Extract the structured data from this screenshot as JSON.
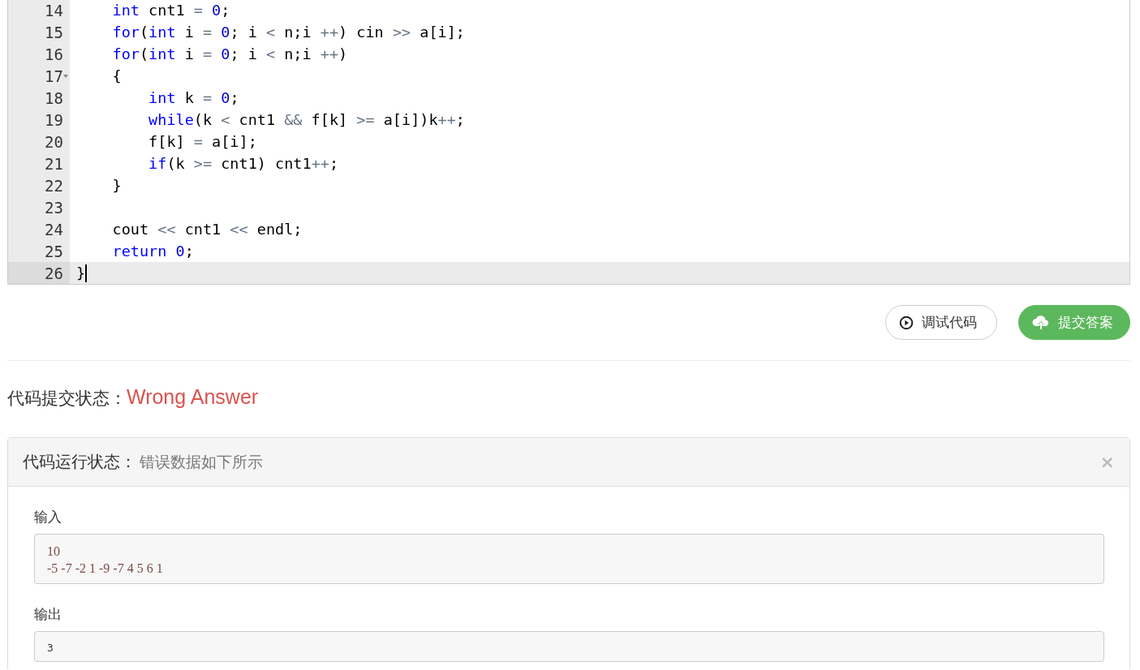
{
  "editor": {
    "lines": [
      {
        "number": "14",
        "foldable": false,
        "active": false,
        "tokens": [
          {
            "kind": "keyword",
            "text": "    int"
          },
          {
            "kind": "plain",
            "text": " cnt1 "
          },
          {
            "kind": "operator",
            "text": "= "
          },
          {
            "kind": "number",
            "text": "0"
          },
          {
            "kind": "plain",
            "text": ";"
          }
        ]
      },
      {
        "number": "15",
        "foldable": false,
        "active": false,
        "tokens": [
          {
            "kind": "keyword",
            "text": "    for"
          },
          {
            "kind": "plain",
            "text": "("
          },
          {
            "kind": "keyword",
            "text": "int"
          },
          {
            "kind": "plain",
            "text": " i "
          },
          {
            "kind": "operator",
            "text": "= "
          },
          {
            "kind": "number",
            "text": "0"
          },
          {
            "kind": "plain",
            "text": "; i "
          },
          {
            "kind": "operator",
            "text": "<"
          },
          {
            "kind": "plain",
            "text": " n;i "
          },
          {
            "kind": "operator",
            "text": "++"
          },
          {
            "kind": "plain",
            "text": ") cin "
          },
          {
            "kind": "operator",
            "text": ">>"
          },
          {
            "kind": "plain",
            "text": " a[i];"
          }
        ]
      },
      {
        "number": "16",
        "foldable": false,
        "active": false,
        "tokens": [
          {
            "kind": "keyword",
            "text": "    for"
          },
          {
            "kind": "plain",
            "text": "("
          },
          {
            "kind": "keyword",
            "text": "int"
          },
          {
            "kind": "plain",
            "text": " i "
          },
          {
            "kind": "operator",
            "text": "= "
          },
          {
            "kind": "number",
            "text": "0"
          },
          {
            "kind": "plain",
            "text": "; i "
          },
          {
            "kind": "operator",
            "text": "<"
          },
          {
            "kind": "plain",
            "text": " n;i "
          },
          {
            "kind": "operator",
            "text": "++"
          },
          {
            "kind": "plain",
            "text": ")"
          }
        ]
      },
      {
        "number": "17",
        "foldable": true,
        "active": false,
        "tokens": [
          {
            "kind": "plain",
            "text": "    {"
          }
        ]
      },
      {
        "number": "18",
        "foldable": false,
        "active": false,
        "tokens": [
          {
            "kind": "keyword",
            "text": "        int"
          },
          {
            "kind": "plain",
            "text": " k "
          },
          {
            "kind": "operator",
            "text": "= "
          },
          {
            "kind": "number",
            "text": "0"
          },
          {
            "kind": "plain",
            "text": ";"
          }
        ]
      },
      {
        "number": "19",
        "foldable": false,
        "active": false,
        "tokens": [
          {
            "kind": "keyword",
            "text": "        while"
          },
          {
            "kind": "plain",
            "text": "(k "
          },
          {
            "kind": "operator",
            "text": "<"
          },
          {
            "kind": "plain",
            "text": " cnt1 "
          },
          {
            "kind": "operator",
            "text": "&&"
          },
          {
            "kind": "plain",
            "text": " f[k] "
          },
          {
            "kind": "operator",
            "text": ">="
          },
          {
            "kind": "plain",
            "text": " a[i])k"
          },
          {
            "kind": "operator",
            "text": "++"
          },
          {
            "kind": "plain",
            "text": ";"
          }
        ]
      },
      {
        "number": "20",
        "foldable": false,
        "active": false,
        "tokens": [
          {
            "kind": "plain",
            "text": "        f[k] "
          },
          {
            "kind": "operator",
            "text": "="
          },
          {
            "kind": "plain",
            "text": " a[i];"
          }
        ]
      },
      {
        "number": "21",
        "foldable": false,
        "active": false,
        "tokens": [
          {
            "kind": "keyword",
            "text": "        if"
          },
          {
            "kind": "plain",
            "text": "(k "
          },
          {
            "kind": "operator",
            "text": ">="
          },
          {
            "kind": "plain",
            "text": " cnt1) cnt1"
          },
          {
            "kind": "operator",
            "text": "++"
          },
          {
            "kind": "plain",
            "text": ";"
          }
        ]
      },
      {
        "number": "22",
        "foldable": false,
        "active": false,
        "tokens": [
          {
            "kind": "plain",
            "text": "    }"
          }
        ]
      },
      {
        "number": "23",
        "foldable": false,
        "active": false
      },
      {
        "number": "24",
        "foldable": false,
        "active": false,
        "tokens": [
          {
            "kind": "plain",
            "text": "    cout "
          },
          {
            "kind": "operator",
            "text": "<<"
          },
          {
            "kind": "plain",
            "text": " cnt1 "
          },
          {
            "kind": "operator",
            "text": "<<"
          },
          {
            "kind": "plain",
            "text": " endl;"
          }
        ]
      },
      {
        "number": "25",
        "foldable": false,
        "active": false,
        "tokens": [
          {
            "kind": "keyword",
            "text": "    return"
          },
          {
            "kind": "number",
            "text": " 0"
          },
          {
            "kind": "plain",
            "text": ";"
          }
        ]
      },
      {
        "number": "26",
        "foldable": false,
        "active": true,
        "tokens": [
          {
            "kind": "plain",
            "text": "}"
          }
        ]
      }
    ]
  },
  "actions": [
    {
      "kind": "debug",
      "label": "调试代码"
    },
    {
      "kind": "submit",
      "label": "提交答案"
    }
  ],
  "submission": {
    "label": "代码提交状态：",
    "status": "Wrong Answer"
  },
  "run_panel": {
    "title": "代码运行状态：",
    "subtitle": "错误数据如下所示",
    "close": "×",
    "sections": [
      {
        "label": "输入",
        "kind": "input",
        "lines": [
          "10",
          "-5 -7 -2 1 -9 -7 4 5 6 1"
        ]
      },
      {
        "label": "输出",
        "kind": "output",
        "lines": [
          "3"
        ]
      }
    ]
  }
}
